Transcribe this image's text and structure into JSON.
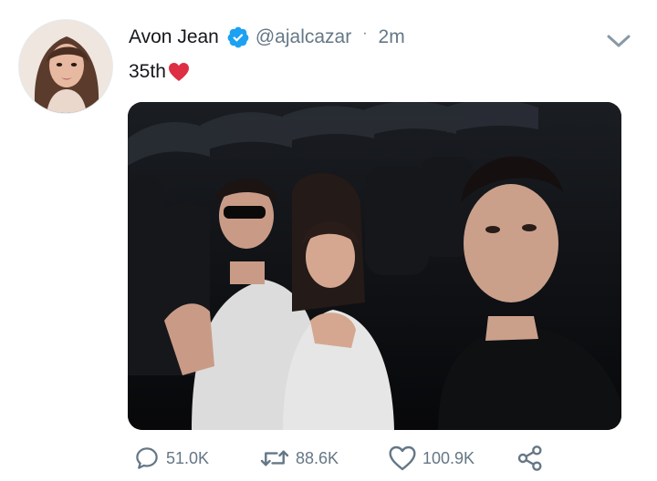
{
  "tweet": {
    "author_name": "Avon Jean",
    "handle": "@ajalcazar",
    "separator": "·",
    "time": "2m",
    "text": "35th"
  },
  "icons": {
    "verified": "verified-badge-icon",
    "caret": "chevron-down-icon",
    "reply": "reply-icon",
    "retweet": "retweet-icon",
    "like": "heart-outline-icon",
    "share": "share-icon",
    "emoji": "red-heart-emoji"
  },
  "metrics": {
    "replies": "51.0K",
    "retweets": "88.6K",
    "likes": "100.9K"
  },
  "colors": {
    "text_primary": "#14171a",
    "text_secondary": "#657786",
    "verified_blue": "#1da1f2",
    "heart_red": "#e0245e"
  }
}
